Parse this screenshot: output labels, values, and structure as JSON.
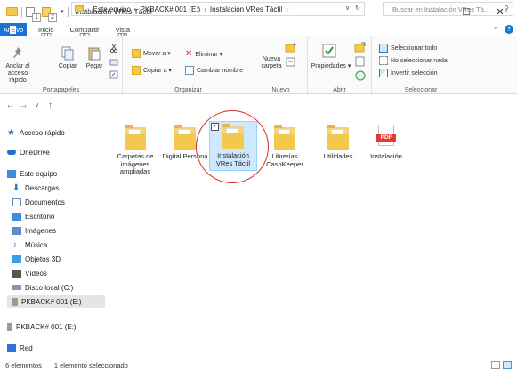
{
  "window": {
    "title": "Instalación VRes Táctil",
    "minimize": "—",
    "maximize": "☐",
    "close": "✕"
  },
  "quick_access": {
    "badge1": "1",
    "badge2": "2"
  },
  "ribbon_tabs": {
    "file": {
      "pre": "Ar",
      "hl": "E",
      "post": "vo"
    },
    "items": [
      {
        "label": "Inicio",
        "key": "H"
      },
      {
        "label": "Compartir",
        "key": "S"
      },
      {
        "label": "Vista",
        "key": "V"
      }
    ]
  },
  "ribbon": {
    "portapapeles": {
      "label": "Portapapeles",
      "pin_label": "Anclar al acceso rápido",
      "copy_label": "Copiar",
      "paste_label": "Pegar"
    },
    "organizar": {
      "label": "Organizar",
      "move": "Mover a ▾",
      "copy_to": "Copiar a ▾",
      "delete": "Eliminar ▾",
      "rename": "Cambiar nombre"
    },
    "nuevo": {
      "label": "Nuevo",
      "new_folder": "Nueva carpeta"
    },
    "abrir": {
      "label": "Abrir",
      "properties": "Propiedades ▾"
    },
    "seleccionar": {
      "label": "Seleccionar",
      "select_all": "Seleccionar todo",
      "select_none": "No seleccionar nada",
      "invert": "Invertir selección"
    }
  },
  "address": {
    "crumbs": [
      "Este equipo",
      "PKBACK# 001 (E:)",
      "Instalación VRes Táctil"
    ],
    "search_placeholder": "Buscar en Instalación VRes Tá..."
  },
  "nav": {
    "items": [
      {
        "label": "Acceso rápido",
        "icon": "star-icon",
        "color": "#2b74d6"
      },
      {
        "label": "OneDrive",
        "icon": "cloud-icon",
        "color": "#1f6fd1"
      },
      {
        "label": "Este equipo",
        "icon": "computer-icon",
        "color": "#3b8de0"
      },
      {
        "label": "Descargas",
        "icon": "download-icon",
        "color": "#2b74d6"
      },
      {
        "label": "Documentos",
        "icon": "document-icon",
        "color": "#6d8cb1"
      },
      {
        "label": "Escritorio",
        "icon": "desktop-icon",
        "color": "#3b8de0"
      },
      {
        "label": "Imágenes",
        "icon": "image-icon",
        "color": "#5a8fc4"
      },
      {
        "label": "Música",
        "icon": "music-icon",
        "color": "#2b74d6"
      },
      {
        "label": "Objetos 3D",
        "icon": "cube-icon",
        "color": "#38a0e8"
      },
      {
        "label": "Vídeos",
        "icon": "video-icon",
        "color": "#555555"
      },
      {
        "label": "Disco local (C:)",
        "icon": "drive-icon",
        "color": "#7a9bbd"
      },
      {
        "label": "PKBACK# 001 (E:)",
        "icon": "usb-drive-icon",
        "color": "#9a9a9a"
      },
      {
        "label": "PKBACK# 001 (E:)",
        "icon": "usb-drive-icon",
        "color": "#9a9a9a"
      },
      {
        "label": "Red",
        "icon": "network-icon",
        "color": "#2b74d6"
      }
    ]
  },
  "files": [
    {
      "name": "Carpetas de imágenes ampliadas",
      "type": "folder"
    },
    {
      "name": "Digital Persona",
      "type": "folder"
    },
    {
      "name": "Instalación VRes Táctil",
      "type": "folder",
      "selected": true
    },
    {
      "name": "Librerías CashKeeper",
      "type": "folder"
    },
    {
      "name": "Utilidades",
      "type": "folder"
    },
    {
      "name": "Instalación",
      "type": "pdf",
      "badge": "PDF"
    }
  ],
  "status": {
    "count": "6 elementos",
    "selected": "1 elemento seleccionado"
  }
}
